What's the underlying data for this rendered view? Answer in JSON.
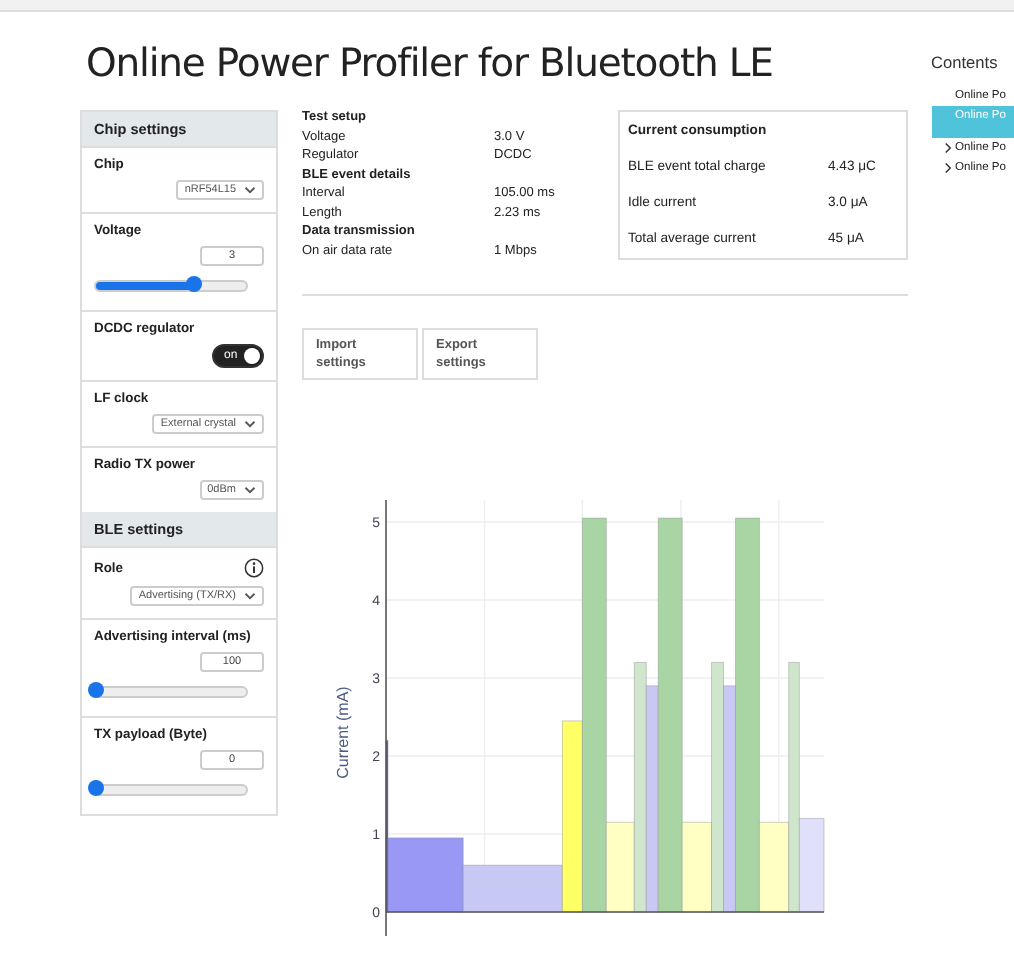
{
  "title": "Online Power Profiler for Bluetooth LE",
  "chip_settings": {
    "header": "Chip settings",
    "chip": {
      "label": "Chip",
      "value": "nRF54L15"
    },
    "voltage": {
      "label": "Voltage",
      "value": "3",
      "level": 0.65
    },
    "dcdc": {
      "label": "DCDC regulator",
      "toggle_text": "on",
      "on": true
    },
    "lf_clock": {
      "label": "LF clock",
      "value": "External crystal"
    },
    "radio_tx_power": {
      "label": "Radio TX power",
      "value": "0dBm"
    }
  },
  "ble_settings": {
    "header": "BLE settings",
    "role": {
      "label": "Role",
      "value": "Advertising (TX/RX)"
    },
    "advertising_interval": {
      "label": "Advertising interval (ms)",
      "value": "100",
      "level": 0
    },
    "tx_payload": {
      "label": "TX payload (Byte)",
      "value": "0",
      "level": 0
    }
  },
  "test_setup": [
    {
      "kind": "heading",
      "label": "Test setup"
    },
    {
      "kind": "row",
      "label": "Voltage",
      "value": "3.0 V"
    },
    {
      "kind": "row",
      "label": "Regulator",
      "value": "DCDC"
    },
    {
      "kind": "heading",
      "label": "BLE event details"
    },
    {
      "kind": "row",
      "label": "Interval",
      "value": "105.00 ms"
    },
    {
      "kind": "row",
      "label": "Length",
      "value": "2.23 ms"
    },
    {
      "kind": "heading",
      "label": "Data transmission"
    },
    {
      "kind": "row",
      "label": "On air data rate",
      "value": "1 Mbps"
    }
  ],
  "current_consumption": {
    "title": "Current consumption",
    "rows": [
      {
        "label": "BLE event total charge",
        "value": "4.43 μC"
      },
      {
        "label": "Idle current",
        "value": "3.0 μA"
      },
      {
        "label": "Total average current",
        "value": "45 μA"
      }
    ]
  },
  "buttons": [
    "Import settings",
    "Export settings"
  ],
  "current_plot": {
    "y_axis_title": "Current (mA)",
    "y_tick_labels": [
      "5",
      "4",
      "3",
      "2",
      "1",
      "0"
    ]
  },
  "contents": {
    "title": "Contents",
    "items": [
      {
        "label": "Online Po",
        "selected": false,
        "expandable": false
      },
      {
        "label": "Online Po",
        "selected": true,
        "expandable": false
      },
      {
        "label": "Online Po",
        "selected": false,
        "expandable": true
      },
      {
        "label": "Online Po",
        "selected": false,
        "expandable": true
      }
    ]
  }
}
